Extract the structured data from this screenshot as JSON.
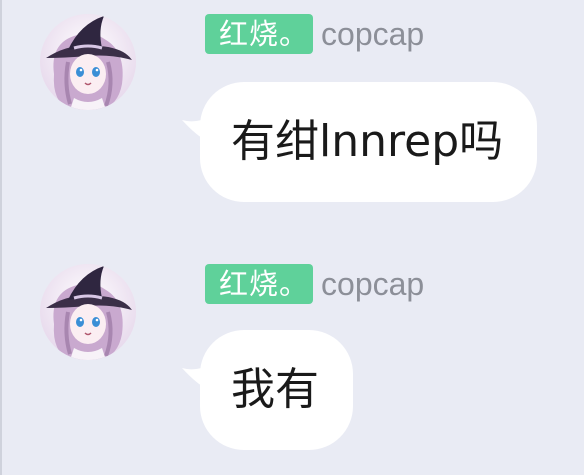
{
  "messages": [
    {
      "title": "红烧。",
      "nickname": "copcap",
      "text": "有绀lnnrep吗"
    },
    {
      "title": "红烧。",
      "nickname": "copcap",
      "text": "我有"
    }
  ],
  "colors": {
    "background": "#e9ebf4",
    "badge": "#5fd19a",
    "badge_text": "#ffffff",
    "nickname": "#8c8f98",
    "bubble": "#ffffff",
    "message_text": "#1a1a1a"
  },
  "icons": {
    "avatar": "anime-witch-avatar"
  }
}
